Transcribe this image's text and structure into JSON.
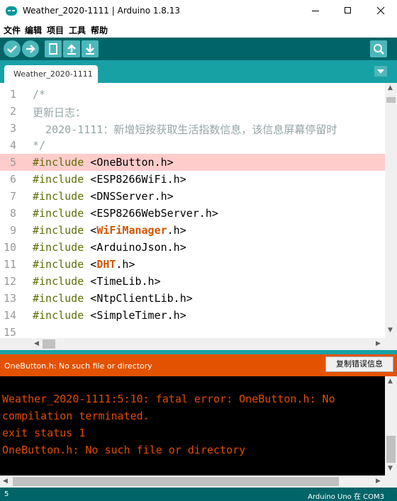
{
  "window": {
    "title": "Weather_2020-1111 | Arduino 1.8.13"
  },
  "menu": [
    "文件",
    "编辑",
    "项目",
    "工具",
    "帮助"
  ],
  "toolbar": {
    "buttons": [
      "verify-icon",
      "upload-icon",
      "new-icon",
      "open-icon",
      "save-icon"
    ],
    "serial_monitor": "serial-monitor-icon"
  },
  "tab": {
    "label": "Weather_2020-1111"
  },
  "editor": {
    "lines": [
      {
        "n": "1",
        "text": "/*",
        "kind": "comment"
      },
      {
        "n": "2",
        "text": "更新日志：",
        "kind": "comment"
      },
      {
        "n": "3",
        "text": "  2020-1111：新增短按获取生活指数信息，该信息屏幕停留时",
        "kind": "comment"
      },
      {
        "n": "4",
        "text": "*/",
        "kind": "comment"
      },
      {
        "n": "5",
        "kw": "#include",
        "pre": " <",
        "lib": "",
        "post": "OneButton.h>",
        "highlight": true
      },
      {
        "n": "6",
        "kw": "#include",
        "pre": " <",
        "lib": "",
        "post": "ESP8266WiFi.h>"
      },
      {
        "n": "7",
        "kw": "#include",
        "pre": " <",
        "lib": "",
        "post": "DNSServer.h>"
      },
      {
        "n": "8",
        "kw": "#include",
        "pre": " <",
        "lib": "",
        "post": "ESP8266WebServer.h>"
      },
      {
        "n": "9",
        "kw": "#include",
        "pre": " <",
        "lib": "WiFiManager",
        "post": ".h>"
      },
      {
        "n": "10",
        "kw": "#include",
        "pre": " <",
        "lib": "",
        "post": "ArduinoJson.h>"
      },
      {
        "n": "11",
        "kw": "#include",
        "pre": " <",
        "lib": "DHT",
        "post": ".h>"
      },
      {
        "n": "12",
        "kw": "#include",
        "pre": " <",
        "lib": "",
        "post": "TimeLib.h>"
      },
      {
        "n": "13",
        "kw": "#include",
        "pre": " <",
        "lib": "",
        "post": "NtpClientLib.h>"
      },
      {
        "n": "14",
        "kw": "#include",
        "pre": " <",
        "lib": "",
        "post": "SimpleTimer.h>"
      },
      {
        "n": "15",
        "text": "",
        "kind": "blank"
      }
    ]
  },
  "status": {
    "message": "OneButton.h: No such file or directory",
    "copy_button": "复制错误信息"
  },
  "console": {
    "lines": [
      "Weather_2020-1111:5:10: fatal error: OneButton.h: No",
      "compilation terminated.",
      "exit status 1",
      "OneButton.h: No such file or directory"
    ]
  },
  "footer": {
    "line": "5",
    "board": "Arduino Uno 在 COM3"
  },
  "colors": {
    "toolbar": "#006468",
    "tabstrip": "#17a1a5",
    "error": "#e35200",
    "highlight": "#ffcccc"
  }
}
